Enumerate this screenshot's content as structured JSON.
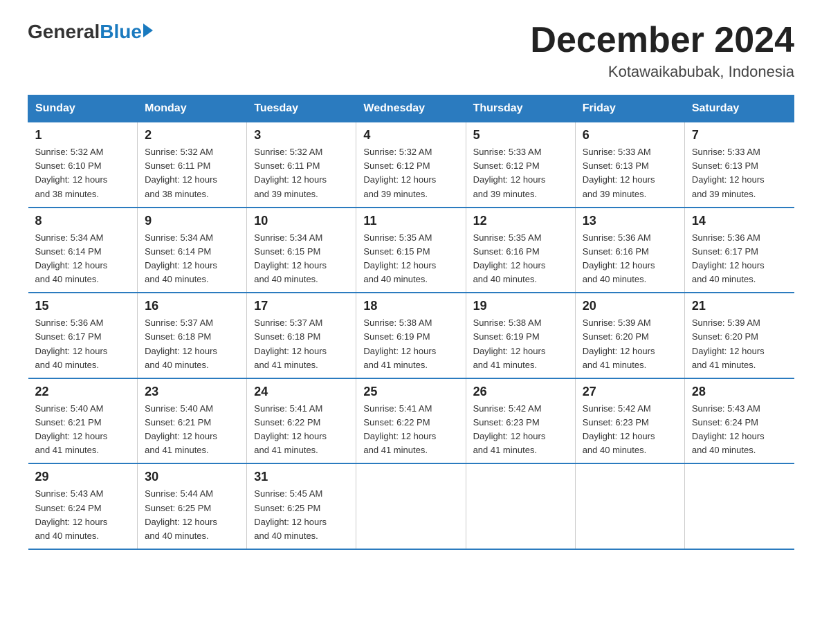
{
  "logo": {
    "general": "General",
    "blue": "Blue"
  },
  "title": "December 2024",
  "subtitle": "Kotawaikabubak, Indonesia",
  "headers": [
    "Sunday",
    "Monday",
    "Tuesday",
    "Wednesday",
    "Thursday",
    "Friday",
    "Saturday"
  ],
  "weeks": [
    [
      {
        "day": "1",
        "sunrise": "5:32 AM",
        "sunset": "6:10 PM",
        "daylight": "12 hours and 38 minutes."
      },
      {
        "day": "2",
        "sunrise": "5:32 AM",
        "sunset": "6:11 PM",
        "daylight": "12 hours and 38 minutes."
      },
      {
        "day": "3",
        "sunrise": "5:32 AM",
        "sunset": "6:11 PM",
        "daylight": "12 hours and 39 minutes."
      },
      {
        "day": "4",
        "sunrise": "5:32 AM",
        "sunset": "6:12 PM",
        "daylight": "12 hours and 39 minutes."
      },
      {
        "day": "5",
        "sunrise": "5:33 AM",
        "sunset": "6:12 PM",
        "daylight": "12 hours and 39 minutes."
      },
      {
        "day": "6",
        "sunrise": "5:33 AM",
        "sunset": "6:13 PM",
        "daylight": "12 hours and 39 minutes."
      },
      {
        "day": "7",
        "sunrise": "5:33 AM",
        "sunset": "6:13 PM",
        "daylight": "12 hours and 39 minutes."
      }
    ],
    [
      {
        "day": "8",
        "sunrise": "5:34 AM",
        "sunset": "6:14 PM",
        "daylight": "12 hours and 40 minutes."
      },
      {
        "day": "9",
        "sunrise": "5:34 AM",
        "sunset": "6:14 PM",
        "daylight": "12 hours and 40 minutes."
      },
      {
        "day": "10",
        "sunrise": "5:34 AM",
        "sunset": "6:15 PM",
        "daylight": "12 hours and 40 minutes."
      },
      {
        "day": "11",
        "sunrise": "5:35 AM",
        "sunset": "6:15 PM",
        "daylight": "12 hours and 40 minutes."
      },
      {
        "day": "12",
        "sunrise": "5:35 AM",
        "sunset": "6:16 PM",
        "daylight": "12 hours and 40 minutes."
      },
      {
        "day": "13",
        "sunrise": "5:36 AM",
        "sunset": "6:16 PM",
        "daylight": "12 hours and 40 minutes."
      },
      {
        "day": "14",
        "sunrise": "5:36 AM",
        "sunset": "6:17 PM",
        "daylight": "12 hours and 40 minutes."
      }
    ],
    [
      {
        "day": "15",
        "sunrise": "5:36 AM",
        "sunset": "6:17 PM",
        "daylight": "12 hours and 40 minutes."
      },
      {
        "day": "16",
        "sunrise": "5:37 AM",
        "sunset": "6:18 PM",
        "daylight": "12 hours and 40 minutes."
      },
      {
        "day": "17",
        "sunrise": "5:37 AM",
        "sunset": "6:18 PM",
        "daylight": "12 hours and 41 minutes."
      },
      {
        "day": "18",
        "sunrise": "5:38 AM",
        "sunset": "6:19 PM",
        "daylight": "12 hours and 41 minutes."
      },
      {
        "day": "19",
        "sunrise": "5:38 AM",
        "sunset": "6:19 PM",
        "daylight": "12 hours and 41 minutes."
      },
      {
        "day": "20",
        "sunrise": "5:39 AM",
        "sunset": "6:20 PM",
        "daylight": "12 hours and 41 minutes."
      },
      {
        "day": "21",
        "sunrise": "5:39 AM",
        "sunset": "6:20 PM",
        "daylight": "12 hours and 41 minutes."
      }
    ],
    [
      {
        "day": "22",
        "sunrise": "5:40 AM",
        "sunset": "6:21 PM",
        "daylight": "12 hours and 41 minutes."
      },
      {
        "day": "23",
        "sunrise": "5:40 AM",
        "sunset": "6:21 PM",
        "daylight": "12 hours and 41 minutes."
      },
      {
        "day": "24",
        "sunrise": "5:41 AM",
        "sunset": "6:22 PM",
        "daylight": "12 hours and 41 minutes."
      },
      {
        "day": "25",
        "sunrise": "5:41 AM",
        "sunset": "6:22 PM",
        "daylight": "12 hours and 41 minutes."
      },
      {
        "day": "26",
        "sunrise": "5:42 AM",
        "sunset": "6:23 PM",
        "daylight": "12 hours and 41 minutes."
      },
      {
        "day": "27",
        "sunrise": "5:42 AM",
        "sunset": "6:23 PM",
        "daylight": "12 hours and 40 minutes."
      },
      {
        "day": "28",
        "sunrise": "5:43 AM",
        "sunset": "6:24 PM",
        "daylight": "12 hours and 40 minutes."
      }
    ],
    [
      {
        "day": "29",
        "sunrise": "5:43 AM",
        "sunset": "6:24 PM",
        "daylight": "12 hours and 40 minutes."
      },
      {
        "day": "30",
        "sunrise": "5:44 AM",
        "sunset": "6:25 PM",
        "daylight": "12 hours and 40 minutes."
      },
      {
        "day": "31",
        "sunrise": "5:45 AM",
        "sunset": "6:25 PM",
        "daylight": "12 hours and 40 minutes."
      },
      null,
      null,
      null,
      null
    ]
  ],
  "labels": {
    "sunrise": "Sunrise:",
    "sunset": "Sunset:",
    "daylight": "Daylight:"
  }
}
